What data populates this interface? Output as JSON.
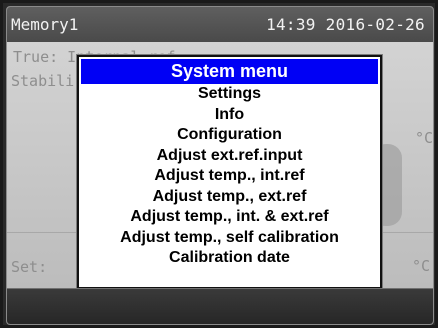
{
  "topbar": {
    "memory": "Memory1",
    "status": "14:39  2016-02-26"
  },
  "background": {
    "true_line": "True: Internal ref.",
    "stable_line": "Stabili",
    "set_line": "Set:",
    "unit_top": "°C",
    "unit_bottom": "°C"
  },
  "modal": {
    "title": "System menu",
    "items": [
      {
        "label": "Settings"
      },
      {
        "label": "Info"
      },
      {
        "label": "Configuration"
      },
      {
        "label": "Adjust ext.ref.input"
      },
      {
        "label": "Adjust temp., int.ref"
      },
      {
        "label": "Adjust temp., ext.ref"
      },
      {
        "label": "Adjust temp., int. & ext.ref"
      },
      {
        "label": "Adjust temp., self calibration"
      },
      {
        "label": "Calibration date"
      }
    ]
  },
  "colors": {
    "title_bar": "#0000f5",
    "title_text": "#ffffff",
    "menu_bg": "#ffffff",
    "menu_text": "#000000"
  }
}
